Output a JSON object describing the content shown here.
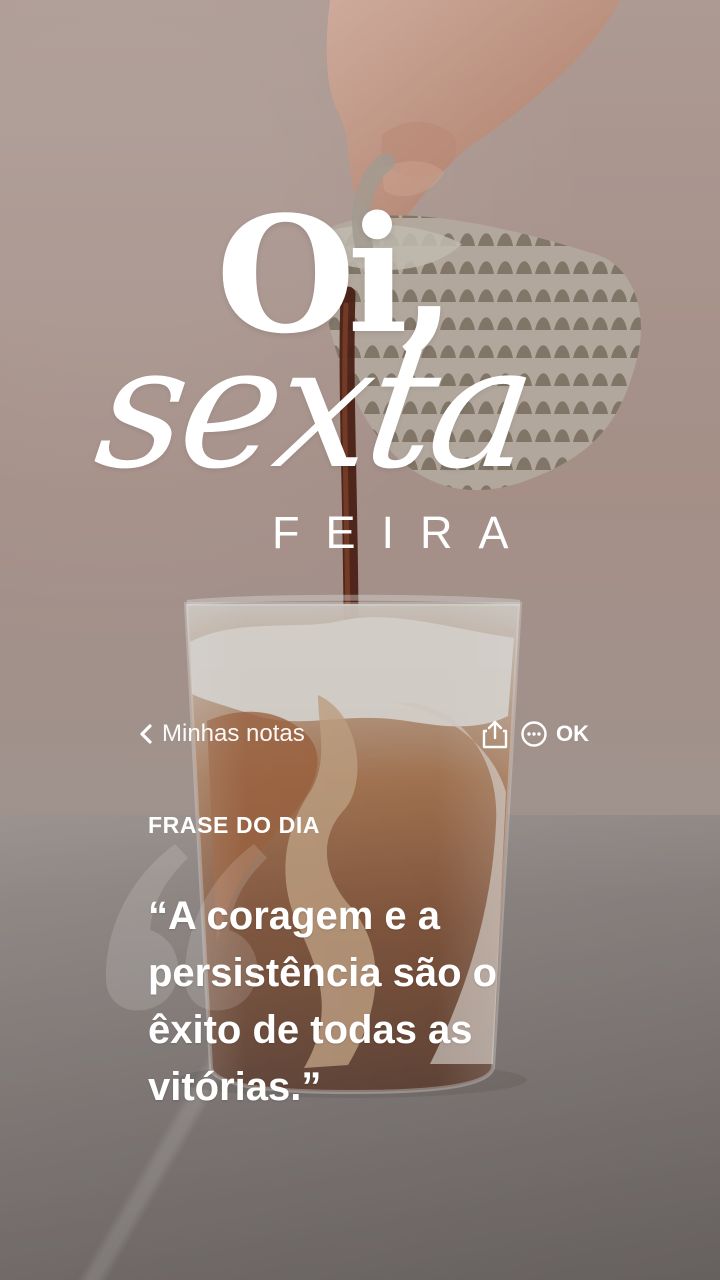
{
  "story": {
    "title": {
      "line1": "Oi,",
      "line2": "sexta",
      "line3": "FEIRA"
    }
  },
  "notes_bar": {
    "back_label": "Minhas notas",
    "ok_label": "OK",
    "icons": {
      "back": "chevron-left-icon",
      "share": "share-icon",
      "more": "more-options-icon"
    }
  },
  "quote": {
    "heading": "FRASE DO DIA",
    "text": "“A coragem e a\npersistência são o\nêxito de todas as\nvitórias.”"
  },
  "colors": {
    "text": "#ffffff",
    "background_warm": "#c7b2ab",
    "coffee": "#6b3b20",
    "foam": "#f2efe9"
  }
}
